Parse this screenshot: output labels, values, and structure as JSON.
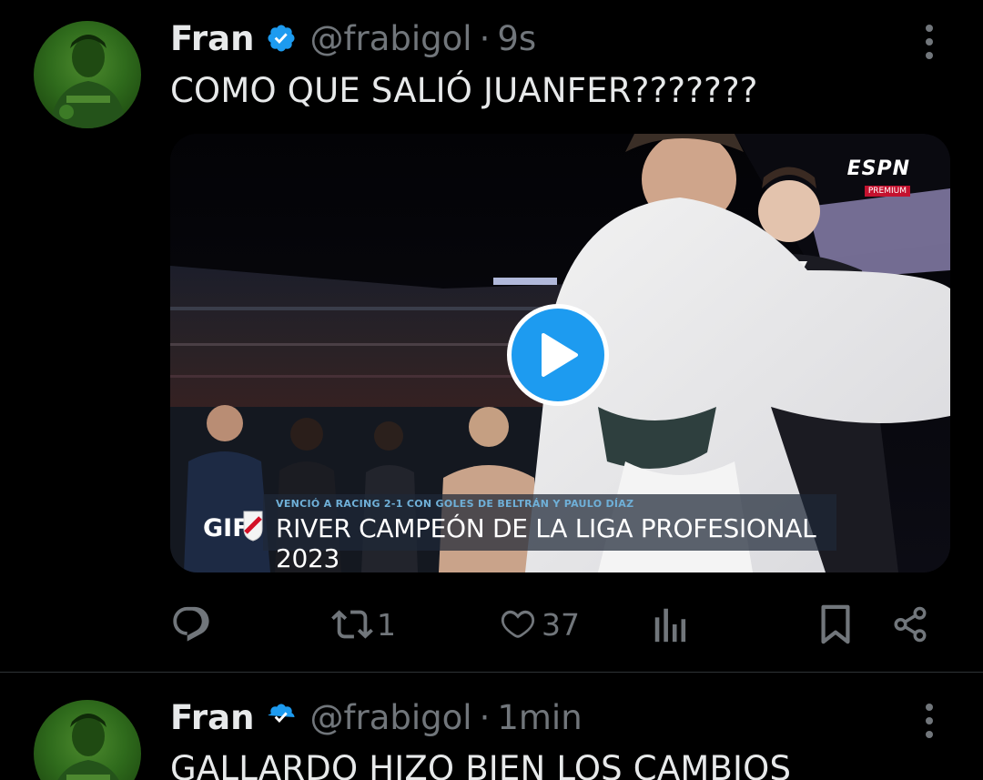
{
  "tweets": [
    {
      "author": {
        "name": "Fran",
        "handle": "@frabigol",
        "verified": true
      },
      "separator": "·",
      "time": "9s",
      "text": "COMO QUE SALIÓ JUANFER???????",
      "media": {
        "type": "gif",
        "badge": "GIF",
        "broadcaster": "ESPN",
        "broadcaster_sub": "PREMIUM",
        "lower_third_small": "VENCIÓ A RACING 2-1 CON GOLES DE BELTRÁN Y PAULO DÍAZ",
        "lower_third_big": "RIVER CAMPEÓN DE LA LIGA PROFESIONAL 2023"
      },
      "actions": {
        "reply": {
          "icon": "reply-icon",
          "count": ""
        },
        "retweet": {
          "icon": "retweet-icon",
          "count": "1"
        },
        "like": {
          "icon": "heart-icon",
          "count": "37"
        },
        "views": {
          "icon": "views-icon",
          "count": ""
        },
        "bookmark": {
          "icon": "bookmark-icon"
        },
        "share": {
          "icon": "share-icon"
        }
      }
    },
    {
      "author": {
        "name": "Fran",
        "handle": "@frabigol",
        "verified": true
      },
      "separator": "·",
      "time": "1min",
      "text": "GALLARDO HIZO BIEN LOS CAMBIOS"
    }
  ],
  "colors": {
    "background": "#000000",
    "text_primary": "#e7e9ea",
    "text_secondary": "#71767b",
    "accent_blue": "#1d9bf0",
    "divider": "#2f3336"
  }
}
